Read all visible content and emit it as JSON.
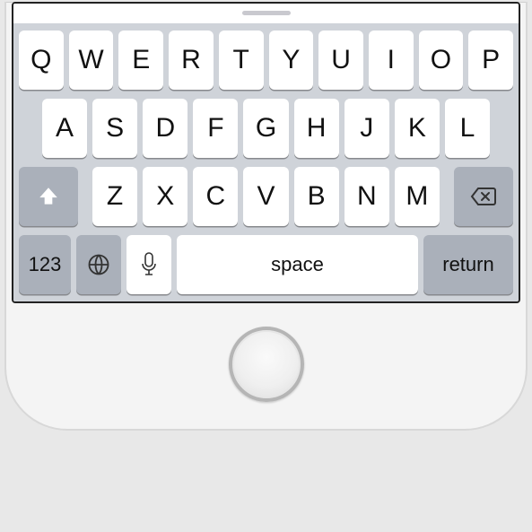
{
  "keyboard": {
    "row1": [
      "Q",
      "W",
      "E",
      "R",
      "T",
      "Y",
      "U",
      "I",
      "O",
      "P"
    ],
    "row2": [
      "A",
      "S",
      "D",
      "F",
      "G",
      "H",
      "J",
      "K",
      "L"
    ],
    "row3": [
      "Z",
      "X",
      "C",
      "V",
      "B",
      "N",
      "M"
    ],
    "numbers_label": "123",
    "space_label": "space",
    "return_label": "return"
  },
  "colors": {
    "key_bg": "#ffffff",
    "fn_key_bg": "#aab0ba",
    "keyboard_bg": "#cfd3d9"
  }
}
